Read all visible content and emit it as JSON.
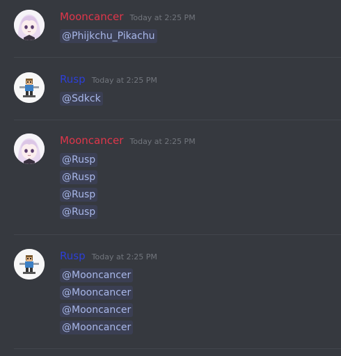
{
  "colors": {
    "background": "#36393f",
    "mooncancer": "#e0364a",
    "rusp": "#2d3fd6",
    "timestamp": "#72767d",
    "mention_text": "#a9b8ea",
    "mention_bg": "#3b3f53"
  },
  "messages": [
    {
      "author": "Mooncancer",
      "avatar_icon": "anime-girl-avatar-icon",
      "timestamp": "Today at 2:25 PM",
      "lines": [
        "@Phijkchu_Pikachu"
      ]
    },
    {
      "author": "Rusp",
      "avatar_icon": "pixel-character-avatar-icon",
      "timestamp": "Today at 2:25 PM",
      "lines": [
        "@Sdkck"
      ]
    },
    {
      "author": "Mooncancer",
      "avatar_icon": "anime-girl-avatar-icon",
      "timestamp": "Today at 2:25 PM",
      "lines": [
        "@Rusp",
        "@Rusp",
        "@Rusp",
        "@Rusp"
      ]
    },
    {
      "author": "Rusp",
      "avatar_icon": "pixel-character-avatar-icon",
      "timestamp": "Today at 2:25 PM",
      "lines": [
        "@Mooncancer",
        "@Mooncancer",
        "@Mooncancer",
        "@Mooncancer"
      ]
    }
  ]
}
